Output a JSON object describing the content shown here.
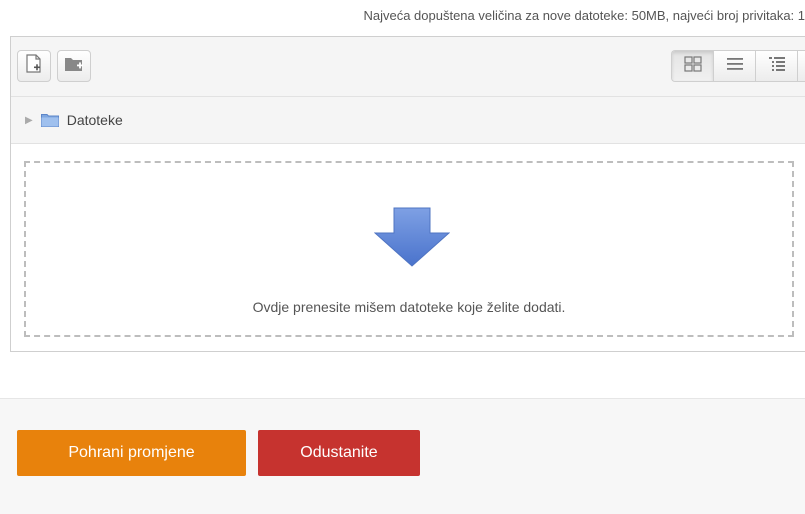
{
  "max_info": "Najveća dopuštena veličina za nove datoteke: 50MB, najveći broj privitaka: 1",
  "path": {
    "folder_label": "Datoteke"
  },
  "dropzone": {
    "message": "Ovdje prenesite mišem datoteke koje želite dodati."
  },
  "buttons": {
    "save": "Pohrani promjene",
    "cancel": "Odustanite"
  },
  "toolbar": {
    "icons": [
      "add-file-icon",
      "create-folder-icon"
    ],
    "views": [
      "icons-view",
      "list-view",
      "tree-view"
    ],
    "active_view": "icons-view"
  },
  "colors": {
    "save": "#e8820c",
    "cancel": "#c6332f",
    "arrow": "#5b83d6",
    "folder": "#7fa7e0"
  }
}
